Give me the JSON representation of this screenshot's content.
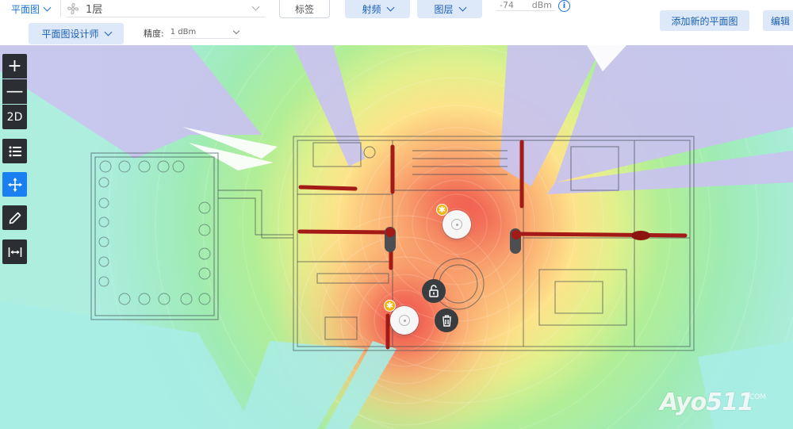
{
  "toolbar": {
    "view_label": "平面图",
    "floor_label": "1层",
    "tags_label": "标签",
    "rf_label": "射频",
    "layer_label": "图层",
    "dbm_value": "-74",
    "dbm_unit": "dBm",
    "info_glyph": "i",
    "add_floorplan_label": "添加新的平面图",
    "edit_label": "编辑",
    "designer_label": "平面图设计师",
    "precision_label": "精度:",
    "precision_value": "1 dBm"
  },
  "tools": {
    "zoom_in": "+",
    "zoom_out": "—",
    "mode": "2D"
  },
  "accent_colors": {
    "primary_blue": "#1a73d9",
    "button_bg": "#dde9f8",
    "tool_bg": "#2b2f33",
    "tool_active": "#1a7ff0",
    "wall_red": "#a41a16"
  },
  "icons": [
    "plus-icon",
    "minus-icon",
    "list-icon",
    "move-icon",
    "pencil-icon",
    "measure-icon",
    "lock-icon",
    "trash-icon",
    "info-icon",
    "fan-icon",
    "chevron-down-icon"
  ],
  "watermark": {
    "main": "Ayo511",
    "dom": ".COM"
  }
}
